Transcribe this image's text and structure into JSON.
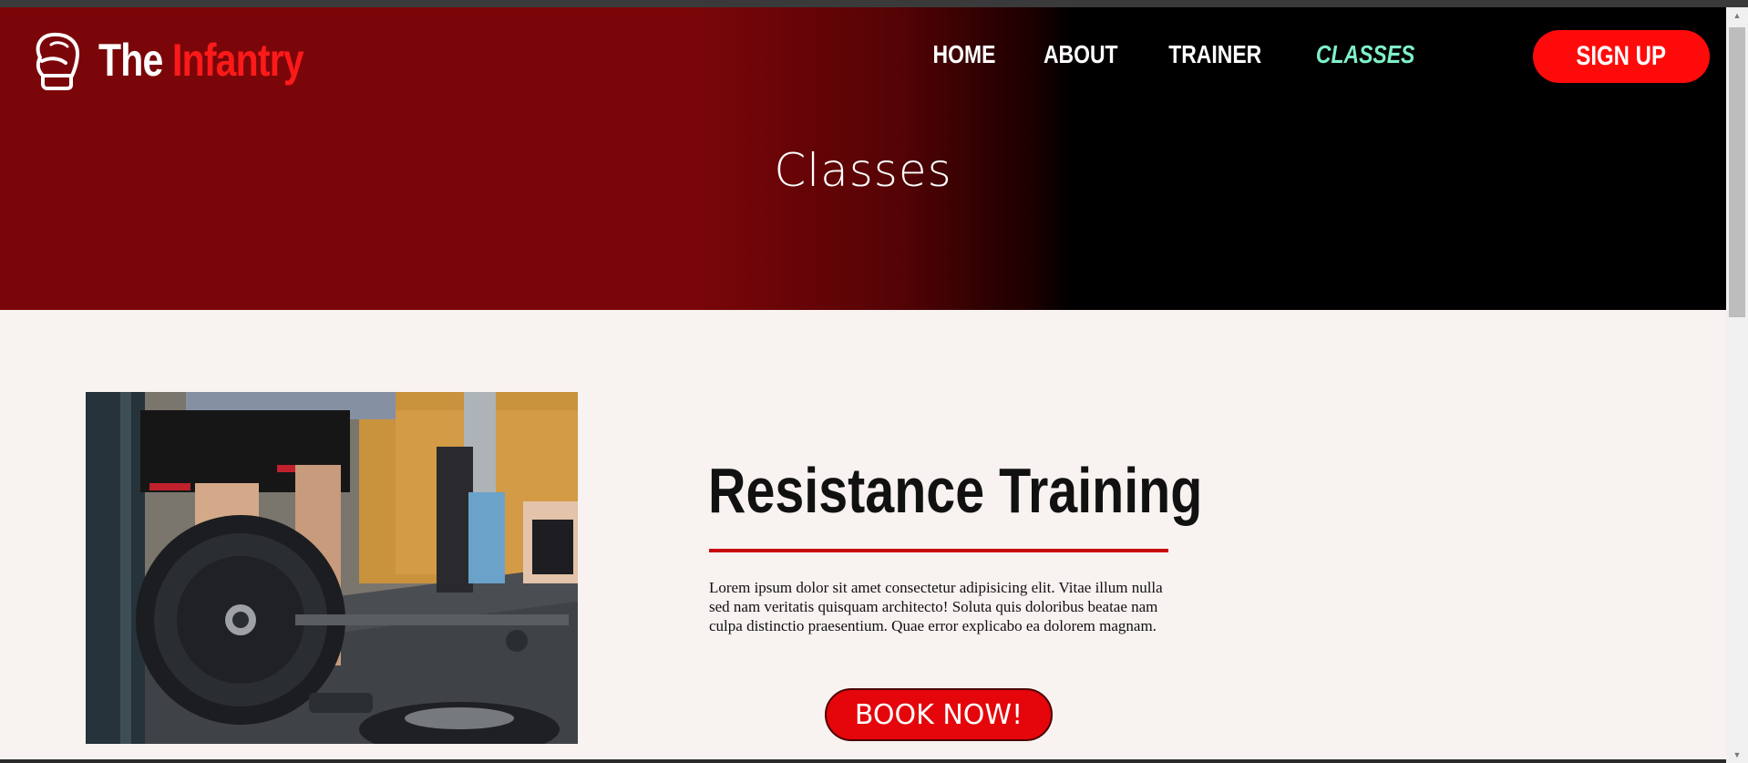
{
  "header": {
    "logo_word1": "The",
    "logo_word2": "Infantry",
    "nav": [
      "HOME",
      "ABOUT",
      "TRAINER",
      "CLASSES"
    ],
    "signup_label": "SIGN UP"
  },
  "hero": {
    "title": "Classes"
  },
  "class": {
    "title": "Resistance Training",
    "description": "Lorem ipsum dolor sit amet consectetur adipisicing elit. Vitae illum nulla sed nam veritatis quisquam architecto! Soluta quis doloribus beatae nam culpa distinctio praesentium. Quae error explicabo ea dolorem magnam.",
    "book_label": "BOOK NOW!"
  },
  "colors": {
    "brand_red": "#ff0a0a",
    "hero_red": "#7b0609",
    "active_nav": "#7ff0c7",
    "divider": "#c7080f"
  },
  "icons": {
    "logo": "boxing-glove-icon"
  }
}
